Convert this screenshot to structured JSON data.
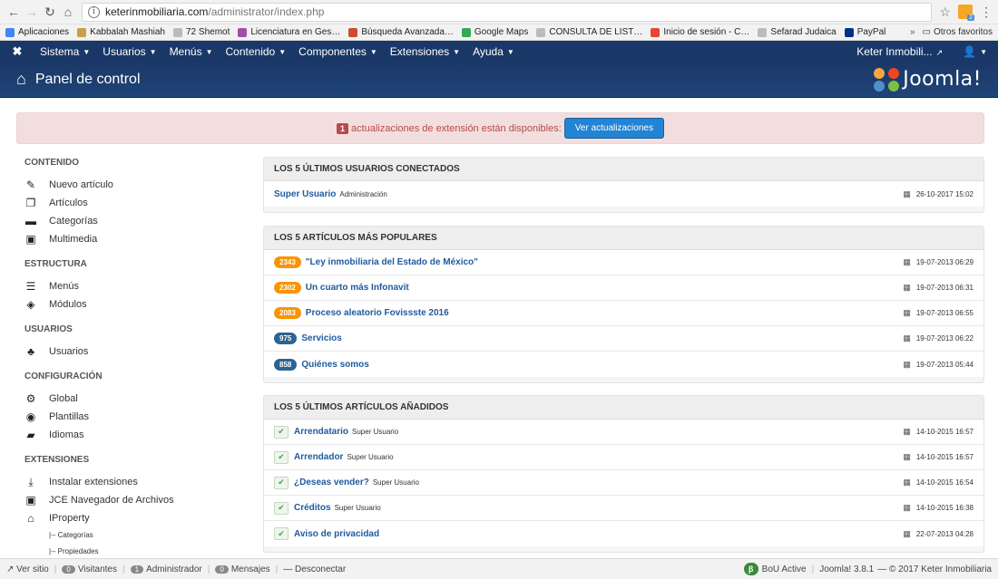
{
  "browser": {
    "url_host": "keterinmobiliaria.com",
    "url_path": "/administrator/index.php",
    "bookmarks": [
      {
        "label": "Aplicaciones",
        "color": "#4285f4"
      },
      {
        "label": "Kabbalah Mashiah",
        "color": "#c8a04a"
      },
      {
        "label": "72 Shemot",
        "color": "#bbbbbb"
      },
      {
        "label": "Licenciatura en Ges…",
        "color": "#a64ca6"
      },
      {
        "label": "Búsqueda Avanzada…",
        "color": "#d04b2a"
      },
      {
        "label": "Google Maps",
        "color": "#34a853"
      },
      {
        "label": "CONSULTA DE LIST…",
        "color": "#bbbbbb"
      },
      {
        "label": "Inicio de sesión - C…",
        "color": "#ea4335"
      },
      {
        "label": "Sefarad Judaica",
        "color": "#bbbbbb"
      },
      {
        "label": "PayPal",
        "color": "#003087"
      }
    ],
    "other_bookmarks": "Otros favoritos",
    "ext_badge": "2"
  },
  "topnav": {
    "menu": [
      "Sistema",
      "Usuarios",
      "Menús",
      "Contenido",
      "Componentes",
      "Extensiones",
      "Ayuda"
    ],
    "site_name": "Keter Inmobili...",
    "user_icon": "user-icon"
  },
  "header": {
    "title": "Panel de control",
    "brand": "Joomla!"
  },
  "alert": {
    "count": "1",
    "text": "actualizaciones de extensión están disponibles:",
    "button": "Ver actualizaciones"
  },
  "sidebar": {
    "groups": [
      {
        "title": "CONTENIDO",
        "items": [
          {
            "label": "Nuevo artículo",
            "icon": "pencil-icon"
          },
          {
            "label": "Artículos",
            "icon": "copy-icon"
          },
          {
            "label": "Categorías",
            "icon": "folder-icon"
          },
          {
            "label": "Multimedia",
            "icon": "image-icon"
          }
        ]
      },
      {
        "title": "ESTRUCTURA",
        "items": [
          {
            "label": "Menús",
            "icon": "list-icon"
          },
          {
            "label": "Módulos",
            "icon": "cube-icon"
          }
        ]
      },
      {
        "title": "USUARIOS",
        "items": [
          {
            "label": "Usuarios",
            "icon": "users-icon"
          }
        ]
      },
      {
        "title": "CONFIGURACIÓN",
        "items": [
          {
            "label": "Global",
            "icon": "cog-icon"
          },
          {
            "label": "Plantillas",
            "icon": "eye-icon"
          },
          {
            "label": "Idiomas",
            "icon": "comments-icon"
          }
        ]
      },
      {
        "title": "EXTENSIONES",
        "items": [
          {
            "label": "Instalar extensiones",
            "icon": "upload-icon"
          },
          {
            "label": "JCE Navegador de Archivos",
            "icon": "image-icon"
          },
          {
            "label": "IProperty",
            "icon": "home-icon"
          }
        ]
      }
    ],
    "subitems": [
      "|-- Categorías",
      "|-- Propiedades"
    ]
  },
  "panels": {
    "users": {
      "title": "LOS 5 ÚLTIMOS USUARIOS CONECTADOS",
      "rows": [
        {
          "name": "Super Usuario",
          "meta": "Administración",
          "date": "26-10-2017 15:02"
        }
      ]
    },
    "popular": {
      "title": "LOS 5 ARTÍCULOS MÁS POPULARES",
      "rows": [
        {
          "hits": "2343",
          "color": "orange",
          "title": "\"Ley inmobiliaria del Estado de México\"",
          "date": "19-07-2013 06:29"
        },
        {
          "hits": "2302",
          "color": "orange",
          "title": "Un cuarto más Infonavit",
          "date": "19-07-2013 06:31"
        },
        {
          "hits": "2083",
          "color": "orange",
          "title": "Proceso aleatorio Fovissste 2016",
          "date": "19-07-2013 06:55"
        },
        {
          "hits": "975",
          "color": "blue",
          "title": "Servicios",
          "date": "19-07-2013 06:22"
        },
        {
          "hits": "858",
          "color": "blue",
          "title": "Quiénes somos",
          "date": "19-07-2013 05:44"
        }
      ]
    },
    "latest": {
      "title": "LOS 5 ÚLTIMOS ARTÍCULOS AÑADIDOS",
      "rows": [
        {
          "title": "Arrendatario",
          "author": "Super Usuario",
          "date": "14-10-2015 16:57"
        },
        {
          "title": "Arrendador",
          "author": "Super Usuario",
          "date": "14-10-2015 16:57"
        },
        {
          "title": "¿Deseas vender?",
          "author": "Super Usuario",
          "date": "14-10-2015 16:54"
        },
        {
          "title": "Créditos",
          "author": "Super Usuario",
          "date": "14-10-2015 16:38"
        },
        {
          "title": "Aviso de privacidad",
          "author": "",
          "date": "22-07-2013 04:28"
        }
      ]
    }
  },
  "statusbar": {
    "view_site": "Ver sitio",
    "visitors_count": "0",
    "visitors": "Visitantes",
    "admin_count": "1",
    "admin": "Administrador",
    "messages_count": "0",
    "messages": "Mensajes",
    "logout": "Desconectar",
    "bou": "BoU Active",
    "version": "Joomla! 3.8.1",
    "copyright": "— © 2017 Keter Inmobiliaria"
  }
}
